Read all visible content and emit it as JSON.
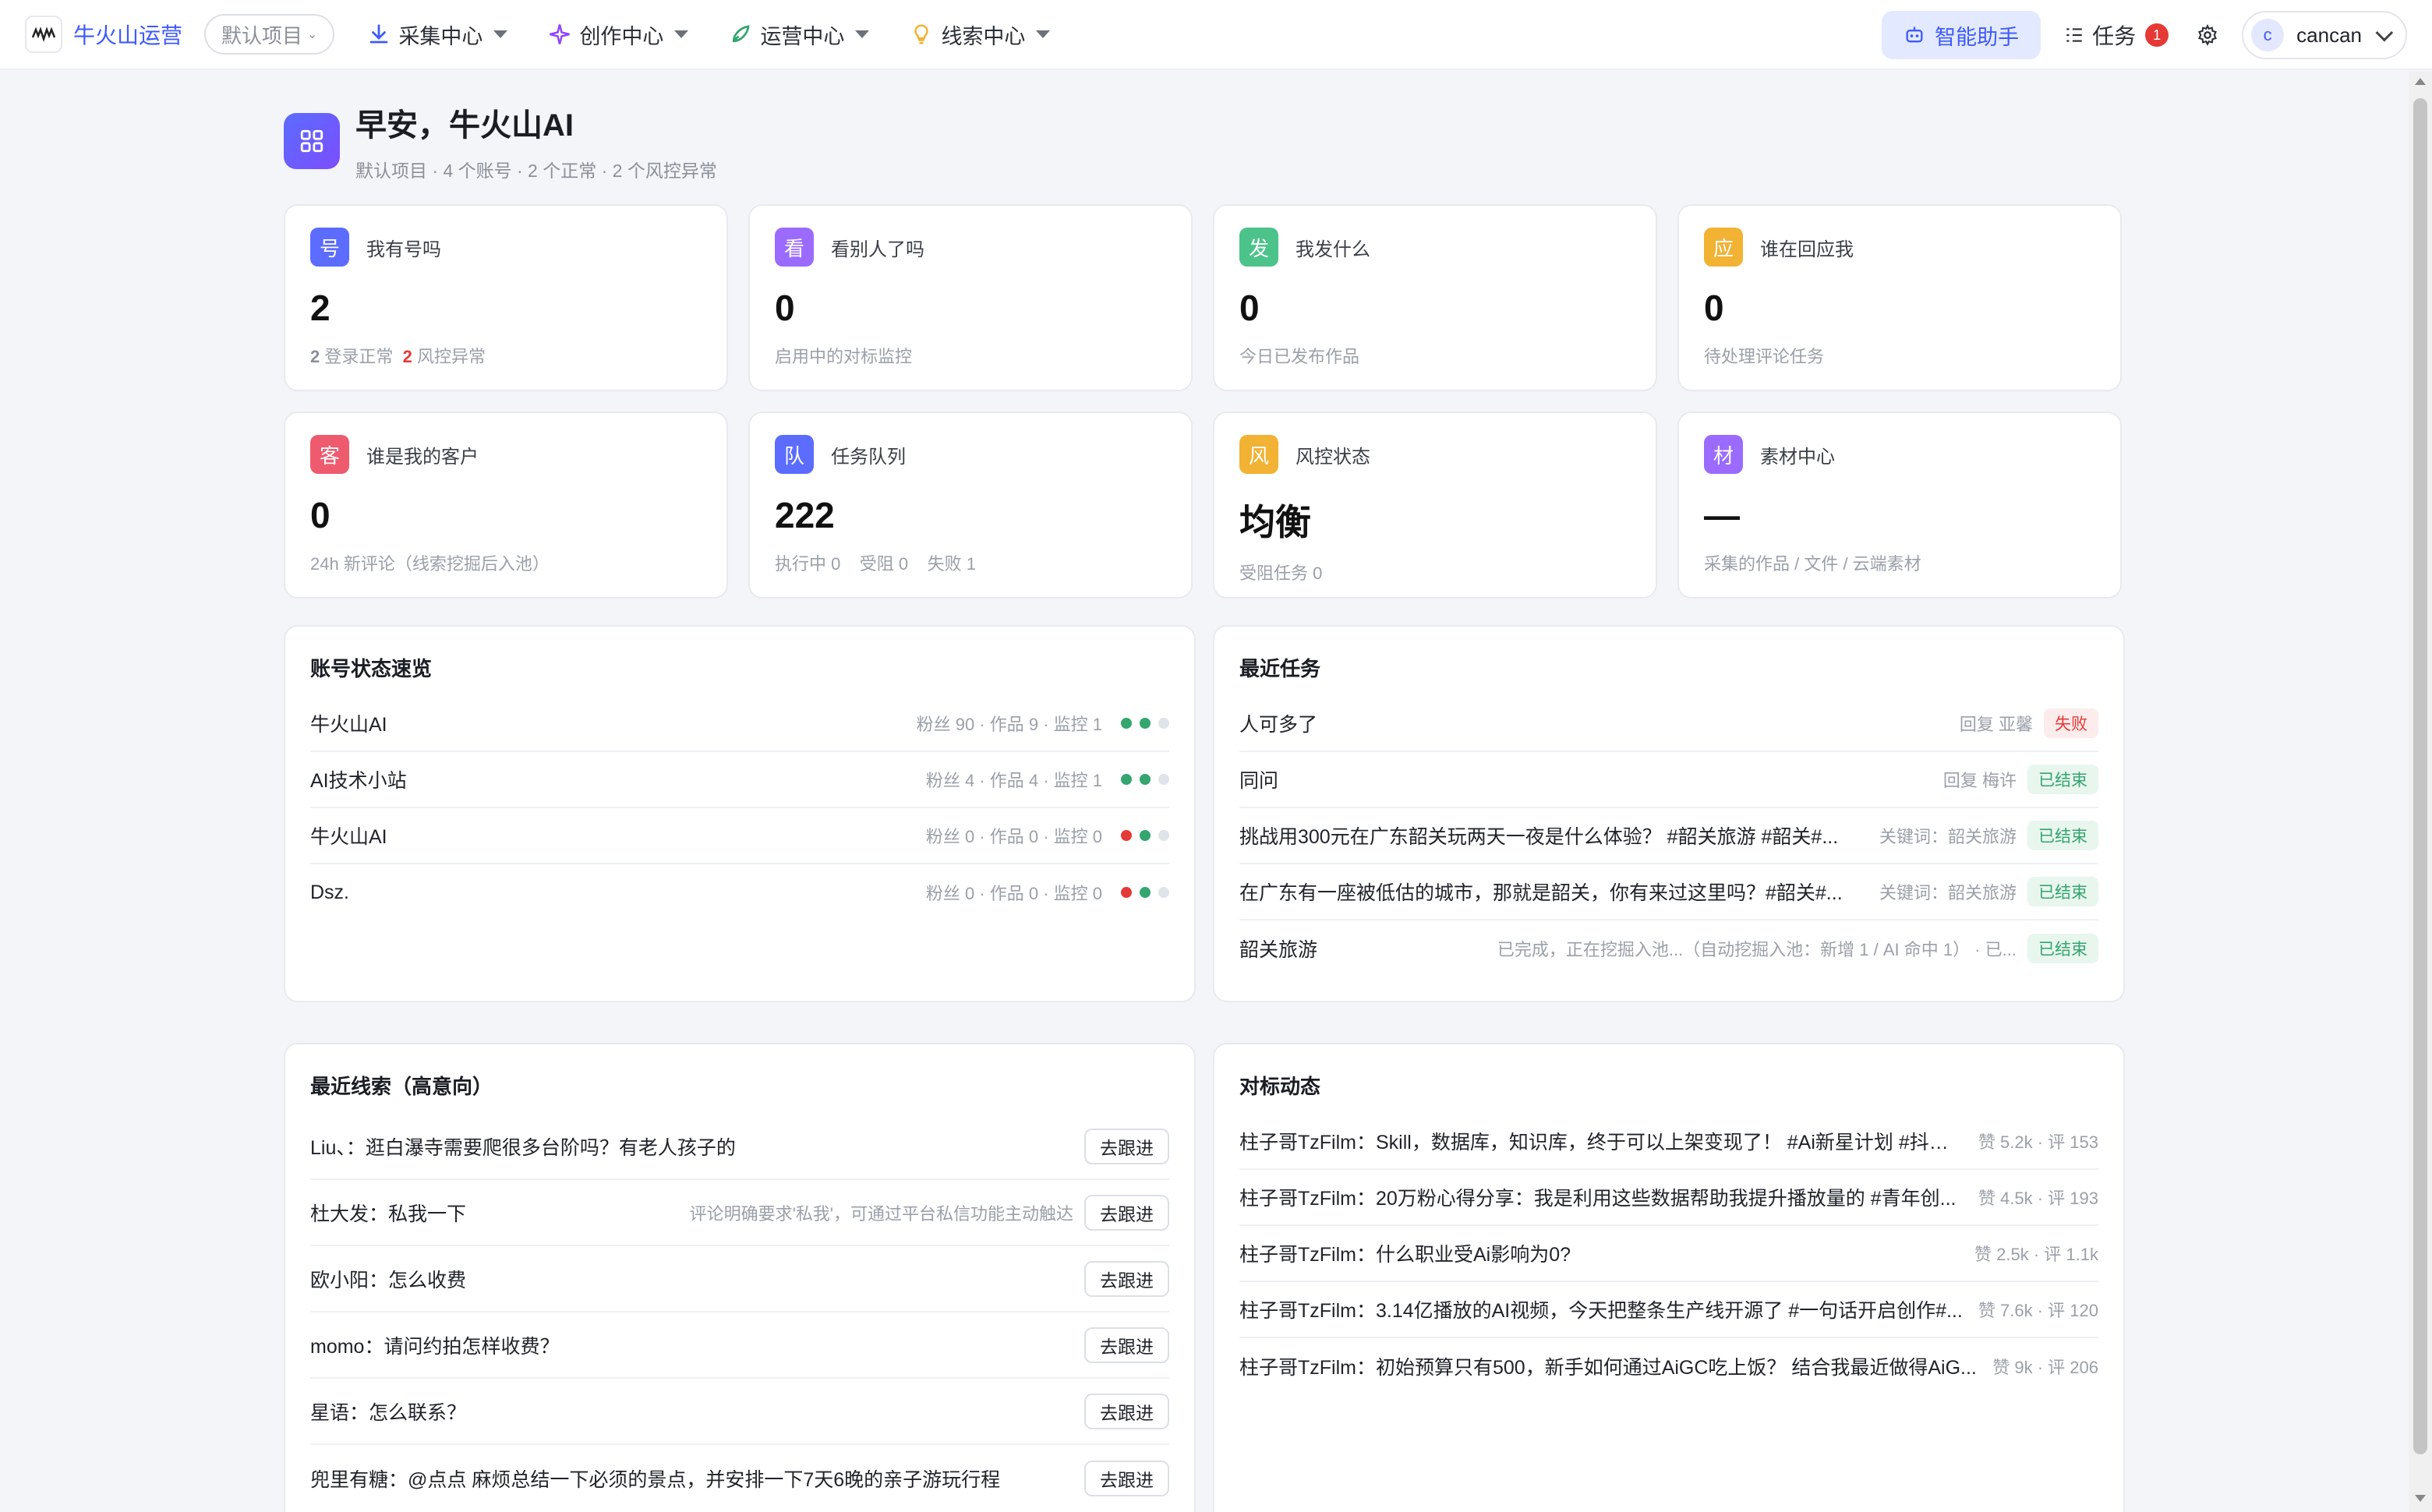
{
  "header": {
    "brand": "牛火山运营",
    "project": "默认项目",
    "nav": [
      {
        "label": "采集中心",
        "icon": "download-icon"
      },
      {
        "label": "创作中心",
        "icon": "sparkle-icon"
      },
      {
        "label": "运营中心",
        "icon": "rocket-icon"
      },
      {
        "label": "线索中心",
        "icon": "lightbulb-icon"
      }
    ],
    "assistant_label": "智能助手",
    "task_label": "任务",
    "task_count": "1",
    "user_initial": "c",
    "user_name": "cancan"
  },
  "greeting": {
    "title": "早安，牛火山AI",
    "subtitle": "默认项目 · 4 个账号 · 2 个正常 · 2 个风控异常"
  },
  "stats": [
    {
      "icon_char": "号",
      "color": "#5b6cff",
      "title": "我有号吗",
      "value": "2",
      "desc_parts": [
        "2",
        " 登录正常  ",
        "2",
        " 风控异常"
      ]
    },
    {
      "icon_char": "看",
      "color": "#9b6bff",
      "title": "看别人了吗",
      "value": "0",
      "desc": "启用中的对标监控"
    },
    {
      "icon_char": "发",
      "color": "#4cc38a",
      "title": "我发什么",
      "value": "0",
      "desc": "今日已发布作品"
    },
    {
      "icon_char": "应",
      "color": "#f2b233",
      "title": "谁在回应我",
      "value": "0",
      "desc": "待处理评论任务"
    },
    {
      "icon_char": "客",
      "color": "#ef5b6e",
      "title": "谁是我的客户",
      "value": "0",
      "desc": "24h 新评论（线索挖掘后入池）"
    },
    {
      "icon_char": "队",
      "color": "#5b6cff",
      "title": "任务队列",
      "value": "222",
      "desc": "执行中 0    受阻 0    失败 1"
    },
    {
      "icon_char": "风",
      "color": "#f2b233",
      "title": "风控状态",
      "value": "均衡",
      "desc": "受阻任务 0"
    },
    {
      "icon_char": "材",
      "color": "#9b6bff",
      "title": "素材中心",
      "value": "—",
      "desc": "采集的作品 / 文件 / 云端素材"
    }
  ],
  "accounts": {
    "title": "账号状态速览",
    "rows": [
      {
        "name": "牛火山AI",
        "meta": "粉丝 90 · 作品 9 · 监控 1",
        "dots": [
          "green",
          "green",
          "gray"
        ]
      },
      {
        "name": "AI技术小站",
        "meta": "粉丝 4 · 作品 4 · 监控 1",
        "dots": [
          "green",
          "green",
          "gray"
        ]
      },
      {
        "name": "牛火山AI",
        "meta": "粉丝 0 · 作品 0 · 监控 0",
        "dots": [
          "red",
          "green",
          "gray"
        ]
      },
      {
        "name": "Dsz.",
        "meta": "粉丝 0 · 作品 0 · 监控 0",
        "dots": [
          "red",
          "green",
          "gray"
        ]
      }
    ]
  },
  "tasks": {
    "title": "最近任务",
    "rows": [
      {
        "name": "人可多了",
        "meta": "回复 亚馨",
        "status": "失败",
        "kind": "fail"
      },
      {
        "name": "同问",
        "meta": "回复 梅许",
        "status": "已结束",
        "kind": "done"
      },
      {
        "name": "挑战用300元在广东韶关玩两天一夜是什么体验？ #韶关旅游 #韶关#...",
        "meta": "关键词：韶关旅游",
        "status": "已结束",
        "kind": "done"
      },
      {
        "name": "在广东有一座被低估的城市，那就是韶关，你有来过这里吗？#韶关#...",
        "meta": "关键词：韶关旅游",
        "status": "已结束",
        "kind": "done"
      },
      {
        "name": "韶关旅游",
        "meta": "已完成，正在挖掘入池...（自动挖掘入池：新增 1 / AI 命中 1） · 已...",
        "status": "已结束",
        "kind": "done"
      }
    ]
  },
  "leads": {
    "title": "最近线索（高意向）",
    "button_label": "去跟进",
    "rows": [
      {
        "text": "Liu、：逛白瀑寺需要爬很多台阶吗？有老人孩子的",
        "meta": ""
      },
      {
        "text": "杜大发：私我一下",
        "meta": "评论明确要求'私我'，可通过平台私信功能主动触达"
      },
      {
        "text": "欧小阳：怎么收费",
        "meta": ""
      },
      {
        "text": "momo：请问约拍怎样收费？",
        "meta": ""
      },
      {
        "text": "星语：怎么联系？",
        "meta": ""
      },
      {
        "text": "兜里有糖：@点点 麻烦总结一下必须的景点，并安排一下7天6晚的亲子游玩行程",
        "meta": ""
      }
    ]
  },
  "benchmark": {
    "title": "对标动态",
    "rows": [
      {
        "text": "柱子哥TzFilm：Skill，数据库，知识库，终于可以上架变现了！ #Ai新星计划 #抖音...",
        "meta": "赞 5.2k · 评 153"
      },
      {
        "text": "柱子哥TzFilm：20万粉心得分享：我是利用这些数据帮助我提升播放量的 #青年创...",
        "meta": "赞 4.5k · 评 193"
      },
      {
        "text": "柱子哥TzFilm：什么职业受Ai影响为0?",
        "meta": "赞 2.5k · 评 1.1k"
      },
      {
        "text": "柱子哥TzFilm：3.14亿播放的AI视频，今天把整条生产线开源了 #一句话开启创作#...",
        "meta": "赞 7.6k · 评 120"
      },
      {
        "text": "柱子哥TzFilm：初始预算只有500，新手如何通过AiGC吃上饭？ 结合我最近做得AiG...",
        "meta": "赞 9k · 评 206"
      }
    ]
  }
}
